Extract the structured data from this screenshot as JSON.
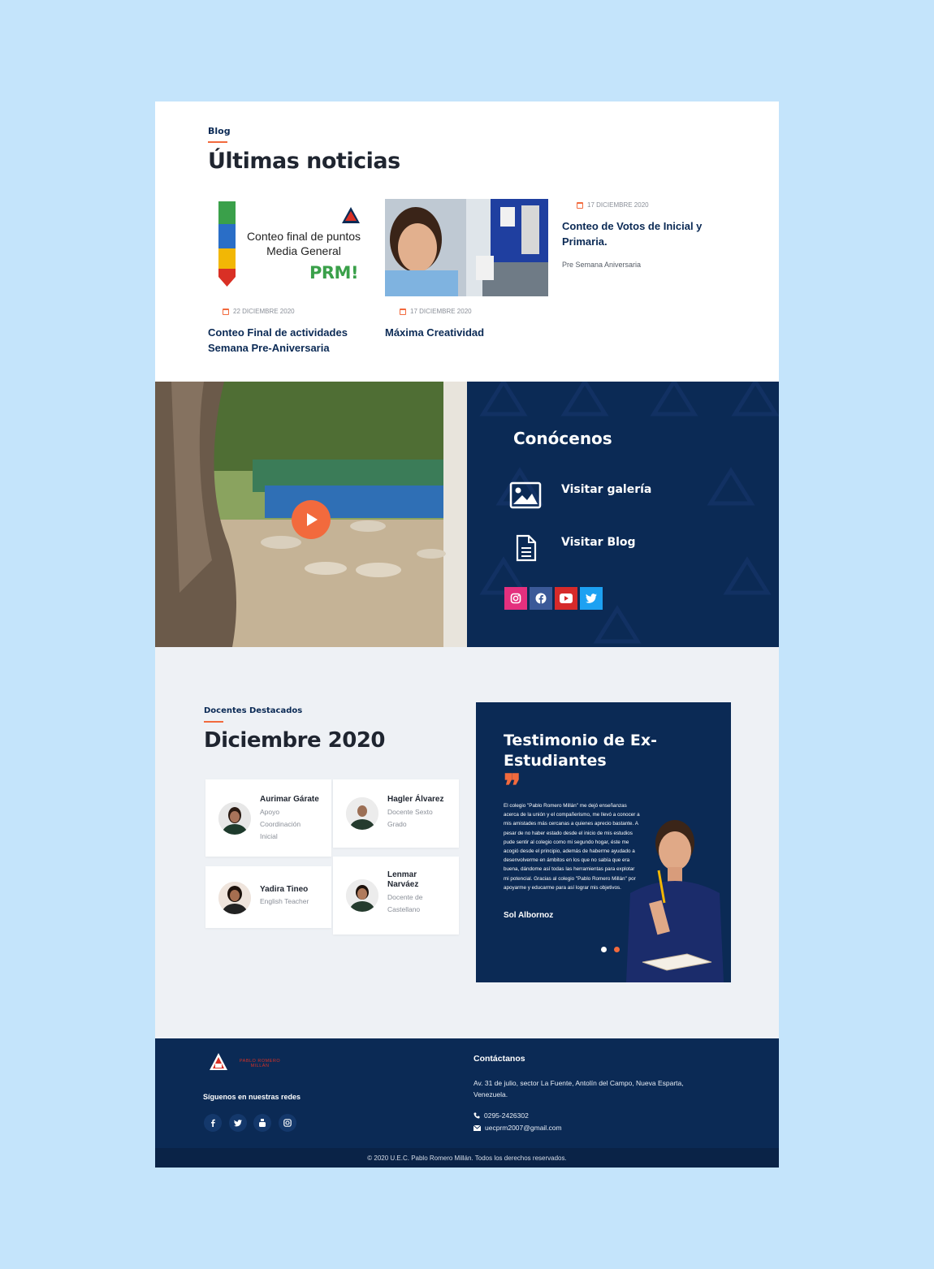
{
  "blog": {
    "eyebrow": "Blog",
    "title": "Últimas noticias",
    "graphic_text": {
      "line1": "Conteo final de puntos",
      "line2": "Media General",
      "brand": "PRM!"
    },
    "posts": [
      {
        "date": "22 DICIEMBRE 2020",
        "title": "Conteo Final de actividades Semana Pre-Aniversaria"
      },
      {
        "date": "17 DICIEMBRE 2020",
        "title": "Máxima Creatividad"
      },
      {
        "date": "17 DICIEMBRE 2020",
        "title": "Conteo de Votos de Inicial y Primaria.",
        "category": "Pre Semana Aniversaria"
      }
    ]
  },
  "know": {
    "title": "Conócenos",
    "gallery_label": "Visitar galería",
    "blog_label": "Visitar Blog",
    "socials": [
      {
        "icon": "instagram-icon",
        "color": "#e4307e"
      },
      {
        "icon": "facebook-icon",
        "color": "#3b5998"
      },
      {
        "icon": "youtube-icon",
        "color": "#d62a2a"
      },
      {
        "icon": "twitter-icon",
        "color": "#1da1f2"
      }
    ]
  },
  "teachers": {
    "eyebrow": "Docentes Destacados",
    "title": "Diciembre 2020",
    "cards": [
      {
        "name": "Aurimar Gárate",
        "role": [
          "Apoyo",
          "Coordinación",
          "Inicial"
        ]
      },
      {
        "name": "Hagler Álvarez",
        "role": [
          "Docente Sexto",
          "Grado"
        ]
      },
      {
        "name": "Yadira Tineo",
        "role": [
          "English Teacher"
        ]
      },
      {
        "name_lines": [
          "Lenmar",
          "Narváez"
        ],
        "role": [
          "Docente de",
          "Castellano"
        ]
      }
    ]
  },
  "testimonial": {
    "title": "Testimonio de Ex-Estudiantes",
    "quote_mark": "❞",
    "text": "El colegio \"Pablo Romero Millán\" me dejó enseñanzas acerca de la unión y el compañerismo, me llevó a conocer a mis amistades más cercanas a quienes aprecio bastante. A pesar de no haber estado desde el inicio de mis estudios pude sentir al colegio como mi segundo hogar, éste me acogió desde el principio, además de haberme ayudado a desenvolverme en ámbitos en los que no sabía que era buena, dándome así todas las herramientas para explotar mi potencial. Gracias al colegio \"Pablo Romero Millán\" por apoyarme y educarme para así lograr mis objetivos.",
    "author": "Sol Albornoz",
    "accent": "#f26a3d"
  },
  "footer": {
    "follow_label": "Síguenos en nuestras redes",
    "contact_title": "Contáctanos",
    "address": "Av. 31 de julio, sector La Fuente, Antolín del Campo, Nueva Esparta, Venezuela.",
    "phone": "0295-2426302",
    "email": "uecprm2007@gmail.com",
    "copyright": "© 2020 U.E.C. Pablo Romero Millán. Todos los derechos reservados.",
    "logo_text": "PABLO ROMERO MILLÁN",
    "social_icons": [
      "facebook-icon",
      "twitter-icon",
      "youtube-icon",
      "instagram-icon"
    ]
  },
  "colors": {
    "navy": "#0b2a55",
    "accent": "#f26a3d",
    "background": "#c4e4fb",
    "light_section": "#eef1f5"
  }
}
